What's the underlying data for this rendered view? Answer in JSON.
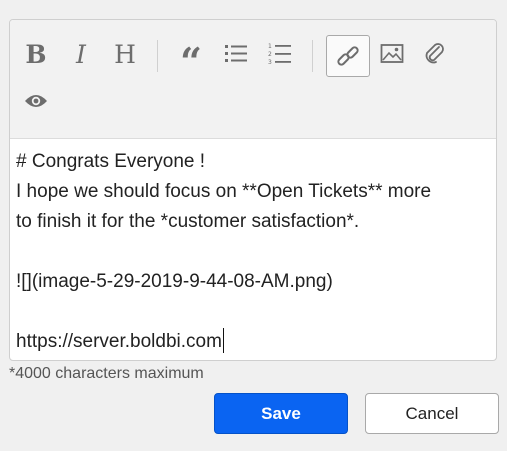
{
  "editor": {
    "toolbar": {
      "bold_label": "B",
      "italic_label": "I",
      "heading_label": "H",
      "quote_label": "“",
      "tools": [
        "bold-icon",
        "italic-icon",
        "heading-icon",
        "quote-icon",
        "unordered-list-icon",
        "ordered-list-icon",
        "link-icon",
        "image-icon",
        "attachment-icon",
        "preview-icon"
      ],
      "active_tool": "link-icon"
    },
    "lines": [
      "# Congrats Everyone !",
      "I hope we should focus on **Open Tickets** more",
      "to finish it for the *customer satisfaction*.",
      "",
      "![](image-5-29-2019-9-44-08-AM.png)",
      "",
      "https://server.boldbi.com"
    ]
  },
  "hint": "*4000 characters maximum",
  "buttons": {
    "save_label": "Save",
    "cancel_label": "Cancel"
  },
  "colors": {
    "save_background": "#0a64f2",
    "toolbar_background": "#f2f2f2",
    "page_background": "#f0f0f0",
    "icon_color": "#6d6d6d"
  }
}
